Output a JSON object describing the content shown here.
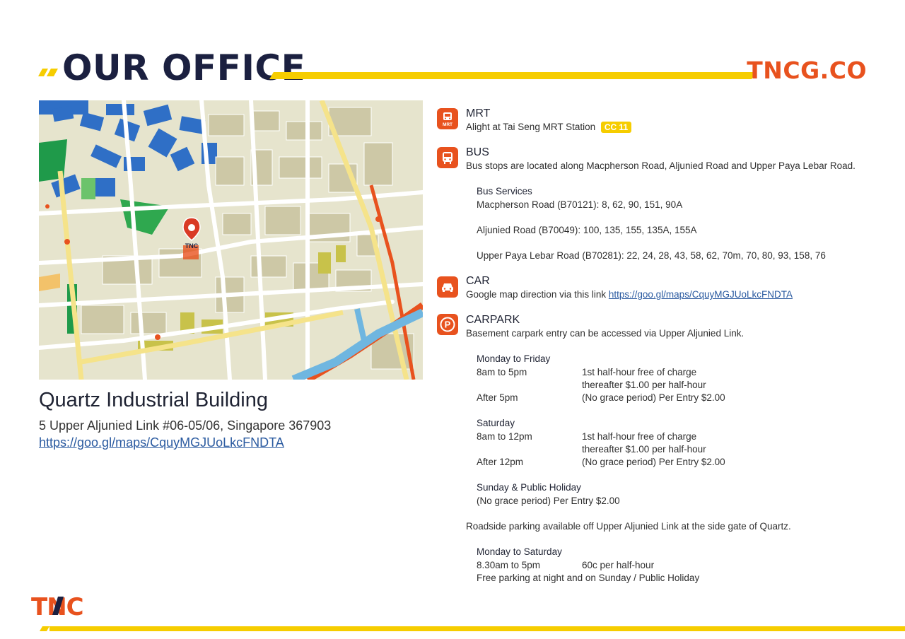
{
  "header": {
    "title": "OUR OFFICE",
    "brand": "TNCG.CO"
  },
  "building": {
    "name": "Quartz Industrial Building",
    "address": "5 Upper Aljunied Link #06-05/06, Singapore 367903",
    "link": "https://goo.gl/maps/CquyMGJUoLkcFNDTA"
  },
  "map": {
    "pin_label": "TNC"
  },
  "mrt": {
    "heading": "MRT",
    "icon_text": "MRT",
    "text": "Alight at Tai Seng MRT Station",
    "badge": "CC 11"
  },
  "bus": {
    "heading": "BUS",
    "text": "Bus stops are located along Macpherson Road, Aljunied Road and Upper Paya Lebar Road.",
    "services_title": "Bus Services",
    "services": [
      "Macpherson Road (B70121): 8, 62, 90, 151, 90A",
      "Aljunied Road (B70049): 100, 135, 155, 135A, 155A",
      "Upper Paya Lebar Road (B70281): 22, 24, 28, 43, 58, 62, 70m, 70, 80, 93, 158, 76"
    ]
  },
  "car": {
    "heading": "CAR",
    "text": "Google map direction via this link",
    "link": "https://goo.gl/maps/CquyMGJUoLkcFNDTA"
  },
  "carpark": {
    "heading": "CARPARK",
    "text": "Basement carpark entry can be accessed via Upper Aljunied Link.",
    "weekday": {
      "title": "Monday to Friday",
      "r1_time": "8am to 5pm",
      "r1_a": "1st half-hour free of charge",
      "r1_b": "thereafter $1.00 per half-hour",
      "r2_time": "After 5pm",
      "r2_a": "(No grace period) Per Entry $2.00"
    },
    "saturday": {
      "title": "Saturday",
      "r1_time": "8am to 12pm",
      "r1_a": "1st half-hour free of charge",
      "r1_b": "thereafter $1.00 per half-hour",
      "r2_time": "After 12pm",
      "r2_a": "(No grace period) Per Entry $2.00"
    },
    "sunday": {
      "title": "Sunday & Public Holiday",
      "text": "(No grace period) Per Entry $2.00"
    },
    "roadside": "Roadside parking available off Upper Aljunied Link at the side gate of Quartz.",
    "mon_sat": {
      "title": "Monday to Saturday",
      "time": "8.30am to 5pm",
      "rate": "60c per half-hour",
      "note": "Free parking at night and on Sunday / Public Holiday"
    }
  },
  "colors": {
    "accent_orange": "#e8521e",
    "accent_yellow": "#f6cd00",
    "navy": "#1b2040"
  },
  "logo_text": "TNC"
}
